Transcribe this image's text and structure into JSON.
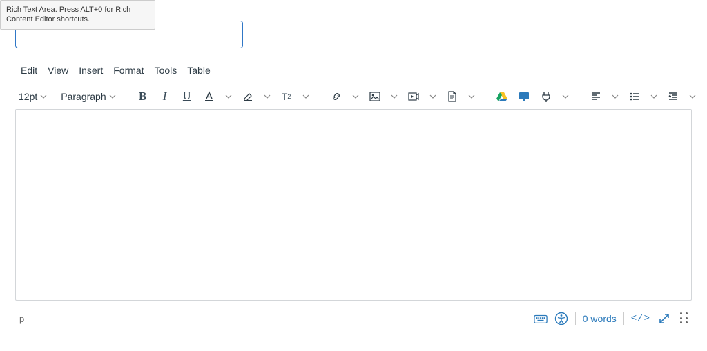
{
  "tooltip": {
    "text": "Rich Text Area. Press ALT+0 for Rich Content Editor shortcuts."
  },
  "menubar": {
    "edit": "Edit",
    "view": "View",
    "insert": "Insert",
    "format": "Format",
    "tools": "Tools",
    "table": "Table"
  },
  "toolbar": {
    "font_size": "12pt",
    "block": "Paragraph"
  },
  "statusbar": {
    "path": "p",
    "word_count": "0 words",
    "html_label": "</>"
  }
}
